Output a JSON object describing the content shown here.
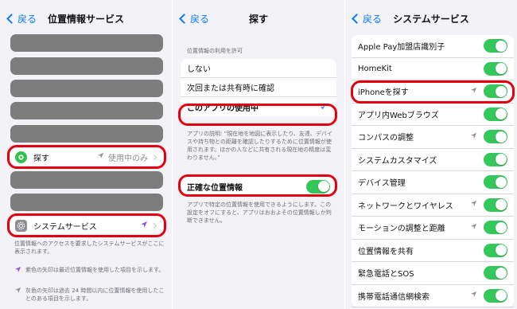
{
  "panel1": {
    "back_label": "戻る",
    "title": "位置情報サービス",
    "find": {
      "label": "探す",
      "value": "使用中のみ",
      "icon": "find-my-icon"
    },
    "system": {
      "label": "システムサービス",
      "icon": "gear-icon",
      "arrow_color": "#9b4dd9"
    },
    "footer": "位置情報へのアクセスを要求したシステムサービスがここに表示されます。",
    "legend": [
      {
        "icon": "purple-location-arrow-icon",
        "color": "#9b4dd9",
        "text": "紫色の矢印は最近位置情報を使用した項目を示します。"
      },
      {
        "icon": "gray-location-arrow-icon",
        "color": "#8e8e93",
        "text": "灰色の矢印は過去 24 時間以内に位置情報を使用したことのある項目を示します。"
      }
    ]
  },
  "panel2": {
    "back_label": "戻る",
    "title": "探す",
    "section_header": "位置情報の利用を許可",
    "options": [
      "しない",
      "次回または共有時に確認",
      "このアプリの使用中"
    ],
    "selected_index": 2,
    "explanation": "アプリの説明: “現在地を地図に表示したり、友達、デバイスや持ち物との距離を確認したりするために位置情報が使用されます。ほかの人などに共有される現在地の精度は変わりません。”",
    "precise_label": "正確な位置情報",
    "precise_on": true,
    "precise_desc": "アプリで特定の位置情報を使用できるようにします。この設定をオフにすると、アプリはおおよその位置情報しか判断できません。"
  },
  "panel3": {
    "back_label": "戻る",
    "title": "システムサービス",
    "items": [
      {
        "label": "Apple Pay加盟店識別子",
        "arrow": false,
        "on": true
      },
      {
        "label": "HomeKit",
        "arrow": false,
        "on": true
      },
      {
        "label": "iPhoneを探す",
        "arrow": true,
        "on": true
      },
      {
        "label": "アプリ内Webブラウズ",
        "arrow": false,
        "on": true
      },
      {
        "label": "コンパスの調整",
        "arrow": true,
        "on": true
      },
      {
        "label": "システムカスタマイズ",
        "arrow": false,
        "on": true
      },
      {
        "label": "デバイス管理",
        "arrow": false,
        "on": true
      },
      {
        "label": "ネットワークとワイヤレス",
        "arrow": true,
        "on": true
      },
      {
        "label": "モーションの調整と距離",
        "arrow": true,
        "on": true
      },
      {
        "label": "位置情報を共有",
        "arrow": false,
        "on": true
      },
      {
        "label": "緊急電話とSOS",
        "arrow": false,
        "on": true
      },
      {
        "label": "携帯電話通信網検索",
        "arrow": true,
        "on": true
      }
    ]
  },
  "colors": {
    "accent": "#0a7aff",
    "toggle_on": "#34c759",
    "highlight": "#e3000f",
    "find_green": "#30c24c",
    "gear_gray": "#8e8e93"
  }
}
